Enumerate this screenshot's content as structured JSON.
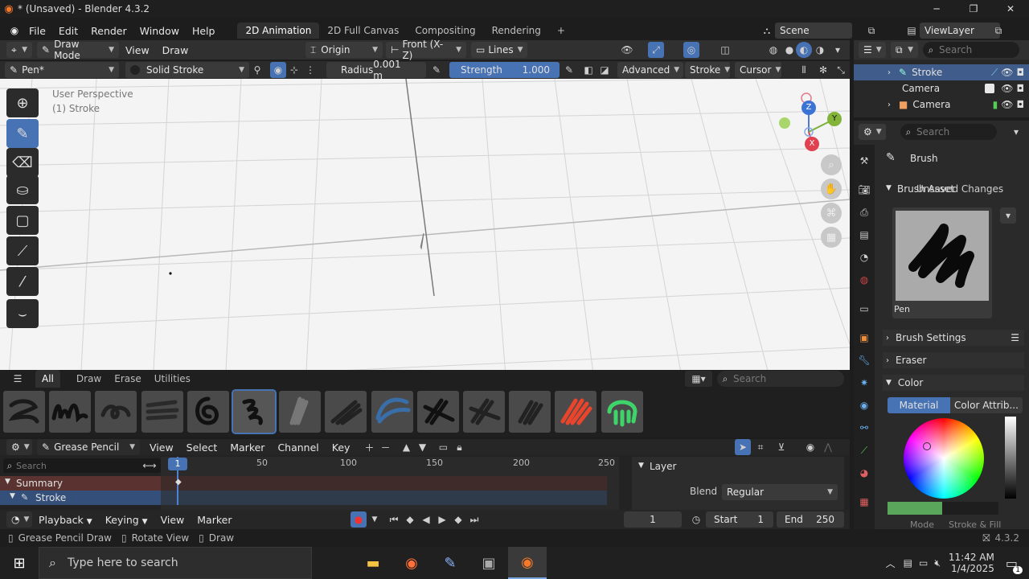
{
  "window": {
    "title": "* (Unsaved) - Blender 4.3.2",
    "minimize": "─",
    "maximize": "❐",
    "close": "✕"
  },
  "menu": {
    "items": [
      "File",
      "Edit",
      "Render",
      "Window",
      "Help"
    ]
  },
  "workspaces": [
    "2D Animation",
    "2D Full Canvas",
    "Compositing",
    "Rendering"
  ],
  "workspace_add": "+",
  "scene": {
    "label": "Scene",
    "view_layer": "ViewLayer"
  },
  "header": {
    "mode": "Draw Mode",
    "view": "View",
    "draw": "Draw",
    "origin": "Origin",
    "orientation": "Front (X-Z)",
    "lines": "Lines"
  },
  "toolsettings": {
    "brush": "Pen*",
    "material": "Solid Stroke",
    "radius_label": "Radius",
    "radius_value": "0.001 m",
    "strength_label": "Strength",
    "strength_value": "1.000",
    "strength_fill": 1.0,
    "advanced": "Advanced",
    "stroke": "Stroke",
    "cursor": "Cursor"
  },
  "viewport": {
    "perspective": "User Perspective",
    "object": "(1) Stroke"
  },
  "gizmo": {
    "z": "Z",
    "y": "Y",
    "x": "X"
  },
  "outliner": {
    "search": "Search",
    "items": [
      {
        "label": "Stroke"
      },
      {
        "label": "Camera"
      },
      {
        "label": "Camera"
      }
    ]
  },
  "properties": {
    "search": "Search",
    "brush_title": "Brush",
    "brush_asset": "Brush Asset",
    "unsaved_changes": "Unsaved Changes",
    "preview_name": "Pen",
    "brush_settings": "Brush Settings",
    "eraser": "Eraser",
    "color": "Color",
    "material_tab": "Material",
    "color_attrib_tab": "Color Attrib...",
    "mode_label": "Mode",
    "mode_value": "Stroke & Fill",
    "accent": "#4772b3"
  },
  "brushes": {
    "tabs": [
      "All",
      "Draw",
      "Erase",
      "Utilities"
    ],
    "search": "Search",
    "count": 14,
    "selected_index": 5
  },
  "timeline": {
    "mode": "Grease Pencil",
    "menus": [
      "View",
      "Select",
      "Marker",
      "Channel",
      "Key"
    ],
    "search": "Search",
    "current_frame": "1",
    "ticks": [
      "50",
      "100",
      "150",
      "200",
      "250"
    ],
    "channels": [
      "Summary",
      "Stroke"
    ],
    "layer_panel": "Layer",
    "blend_label": "Blend",
    "blend_value": "Regular"
  },
  "playback": {
    "playback": "Playback",
    "keying": "Keying",
    "view": "View",
    "marker": "Marker",
    "frame": "1",
    "start_label": "Start",
    "start_value": "1",
    "end_label": "End",
    "end_value": "250"
  },
  "status": {
    "left": "Grease Pencil Draw",
    "mid": "Rotate View",
    "right": "Draw",
    "version": "4.3.2"
  },
  "taskbar": {
    "search": "Type here to search",
    "time": "11:42 AM",
    "date": "1/4/2025",
    "notifications": "1"
  }
}
